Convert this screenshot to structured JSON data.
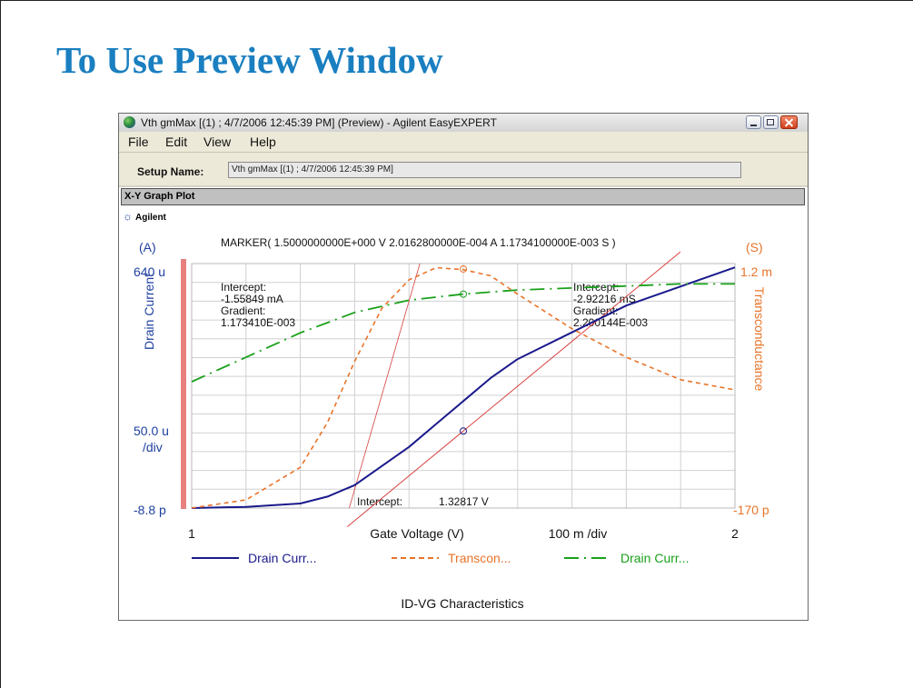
{
  "slide": {
    "title": "To Use Preview Window"
  },
  "window": {
    "title": "Vth gmMax [(1) ; 4/7/2006 12:45:39 PM] (Preview) - Agilent EasyEXPERT",
    "app_icon": "agilent-globe-icon",
    "controls": {
      "minimize": "minimize-icon",
      "maximize": "maximize-icon",
      "close": "close-icon"
    }
  },
  "menu": [
    "File",
    "Edit",
    "View",
    "Help"
  ],
  "setup": {
    "label": "Setup Name:",
    "value": "Vth gmMax [(1) ; 4/7/2006 12:45:39 PM]"
  },
  "panel": {
    "title": "X-Y Graph Plot",
    "brand": "Agilent",
    "brand_icon": "agilent-spark-icon"
  },
  "plot": {
    "marker_text": "MARKER( 1.5000000000E+000 V  2.0162800000E-004 A  1.1734100000E-003 S )",
    "left_unit": "(A)",
    "right_unit": "(S)",
    "left_max": "640 u",
    "left_min": "-8.8 p",
    "left_div": "50.0 u",
    "left_div_unit": "/div",
    "right_max": "1.2 m",
    "right_min": "-170 p",
    "x_min_label": "1",
    "x_max_label": "2",
    "x_div": "100 m /div",
    "left_axis_label": "Drain Current",
    "right_axis_label": "Transconductance",
    "x_axis_label": "Gate Voltage  (V)",
    "intercept_left": [
      "Intercept:",
      "-1.55849 mA",
      "Gradient:",
      "1.173410E-003"
    ],
    "intercept_right": [
      "Intercept:",
      "-2.92216 mS",
      "Gradient:",
      "2.200144E-003"
    ],
    "x_intercept_label": "Intercept:",
    "x_intercept_value": "1.32817 V",
    "footer": "ID-VG Characteristics",
    "colors": {
      "drain": "#1a1a8c",
      "trans": "#e8742a",
      "drain2": "#1aa01a",
      "tangent": "#d84040",
      "axis_bar": "#e88080"
    }
  },
  "legend": [
    {
      "label": "Drain Curr...",
      "color": "#1a1a8c",
      "dash": ""
    },
    {
      "label": "Transcon...",
      "color": "#e8742a",
      "dash": "6,4"
    },
    {
      "label": "Drain Curr...",
      "color": "#1aa01a",
      "dash": "16,6,2,6"
    }
  ],
  "chart_data": {
    "type": "line",
    "x_range": [
      1,
      2
    ],
    "y_left_range": [
      0,
      0.00064
    ],
    "y_right_range": [
      0,
      0.0012
    ],
    "series": [
      {
        "name": "Drain Curr...",
        "axis": "left",
        "x": [
          1.0,
          1.1,
          1.2,
          1.25,
          1.3,
          1.35,
          1.4,
          1.45,
          1.5,
          1.55,
          1.6,
          1.7,
          1.8,
          1.9,
          2.0
        ],
        "y": [
          0.0,
          3e-06,
          1.2e-05,
          3e-05,
          6e-05,
          0.00011,
          0.00016,
          0.00022,
          0.00028,
          0.00034,
          0.00039,
          0.00046,
          0.00053,
          0.00058,
          0.00063
        ]
      },
      {
        "name": "Transcon...",
        "axis": "right",
        "x": [
          1.0,
          1.1,
          1.2,
          1.25,
          1.3,
          1.35,
          1.4,
          1.45,
          1.5,
          1.55,
          1.6,
          1.7,
          1.8,
          1.9,
          2.0
        ],
        "y": [
          0.0,
          4e-05,
          0.0002,
          0.00042,
          0.00072,
          0.00098,
          0.00112,
          0.00118,
          0.00117,
          0.00114,
          0.00105,
          0.00088,
          0.00074,
          0.00063,
          0.00058
        ]
      },
      {
        "name": "Drain Curr...",
        "axis": "right",
        "x": [
          1.0,
          1.1,
          1.2,
          1.3,
          1.4,
          1.5,
          1.6,
          1.7,
          1.8,
          1.9,
          2.0
        ],
        "y": [
          0.00062,
          0.00074,
          0.00086,
          0.00096,
          0.00102,
          0.00105,
          0.00107,
          0.00108,
          0.00109,
          0.0011,
          0.0011
        ]
      }
    ],
    "marker": {
      "x": 1.5,
      "y_left": 0.000201628,
      "y_right": 0.00117341
    },
    "tangent": {
      "x_intercept": 1.32817
    }
  }
}
